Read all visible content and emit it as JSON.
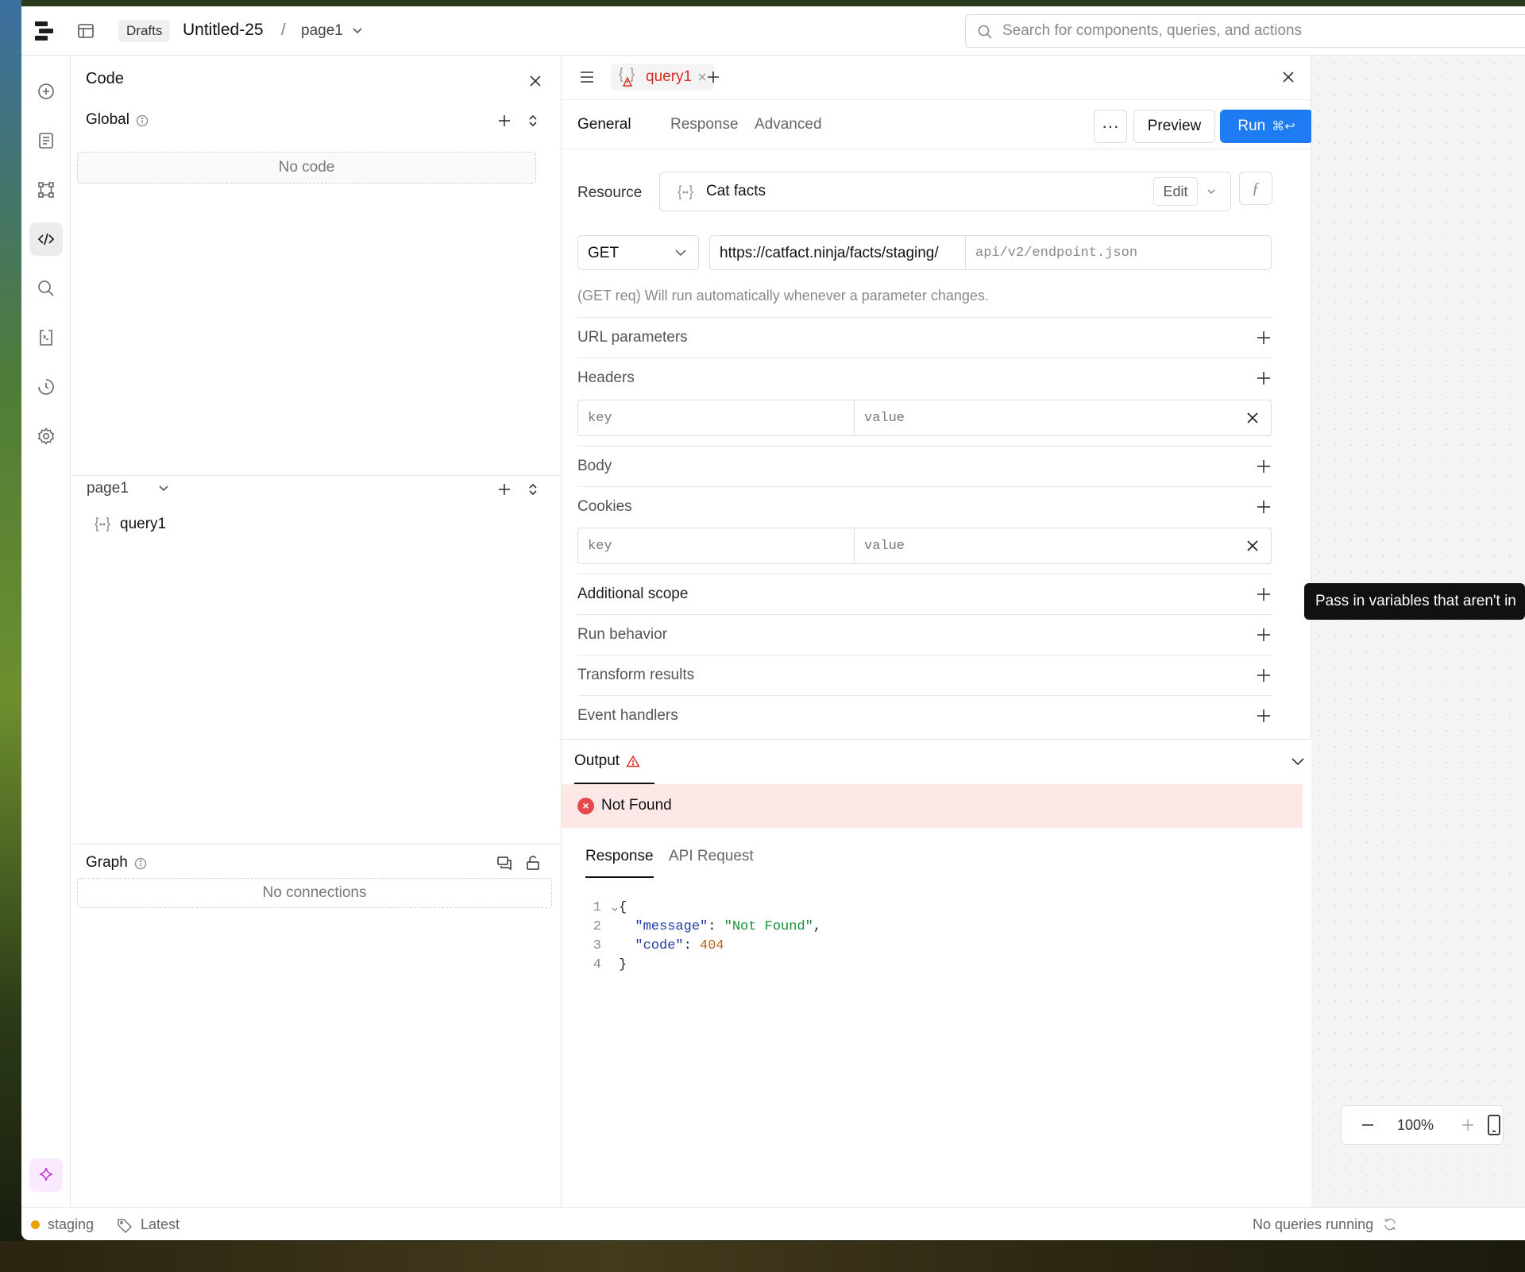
{
  "topbar": {
    "drafts_label": "Drafts",
    "app_title": "Untitled-25",
    "separator": "/",
    "page_name": "page1",
    "search_placeholder": "Search for components, queries, and actions"
  },
  "rail": {
    "icons": [
      "add-circle-icon",
      "pages-icon",
      "components-icon",
      "code-icon",
      "search-icon",
      "state-icon",
      "history-icon",
      "settings-icon"
    ],
    "active": "code-icon",
    "ai_icon": "sparkle-icon"
  },
  "code_panel": {
    "title": "Code",
    "global": {
      "title": "Global",
      "empty": "No code"
    },
    "page": {
      "title": "page1",
      "items": [
        {
          "name": "query1"
        }
      ]
    },
    "graph": {
      "title": "Graph",
      "empty": "No connections"
    }
  },
  "editor": {
    "tab": {
      "label": "query1"
    },
    "subtabs": [
      "General",
      "Response",
      "Advanced"
    ],
    "active_subtab": "General",
    "more_label": "···",
    "preview_label": "Preview",
    "run_label": "Run",
    "run_shortcut": "⌘↩",
    "resource": {
      "label": "Resource",
      "name": "Cat facts",
      "edit_label": "Edit",
      "fx_label": "ƒ"
    },
    "method": "GET",
    "url_base": "https://catfact.ninja/facts/staging/",
    "url_path_placeholder": "api/v2/endpoint.json",
    "hint": "(GET req) Will run automatically whenever a parameter changes.",
    "sections": {
      "url_params": "URL parameters",
      "headers": "Headers",
      "body": "Body",
      "cookies": "Cookies",
      "additional_scope": "Additional scope",
      "run_behavior": "Run behavior",
      "transform_results": "Transform results",
      "event_handlers": "Event handlers"
    },
    "kv_placeholders": {
      "key": "key",
      "value": "value"
    }
  },
  "output": {
    "title": "Output",
    "error": "Not Found",
    "tabs": [
      "Response",
      "API Request"
    ],
    "active_tab": "Response",
    "code": {
      "l1": "1",
      "l2": "2",
      "l3": "3",
      "l4": "4",
      "open": "{",
      "message_key": "\"message\"",
      "message_val": "\"Not Found\"",
      "code_key": "\"code\"",
      "code_val": "404",
      "close": "}"
    }
  },
  "tooltip": "Pass in variables that aren't in",
  "canvas": {
    "zoom": "100%"
  },
  "status": {
    "env": "staging",
    "version": "Latest",
    "queries": "No queries running"
  },
  "colors": {
    "accent": "#1e7bf2",
    "error": "#e5484d",
    "error_bg": "#fde8e8",
    "env_dot": "#e5a400"
  }
}
